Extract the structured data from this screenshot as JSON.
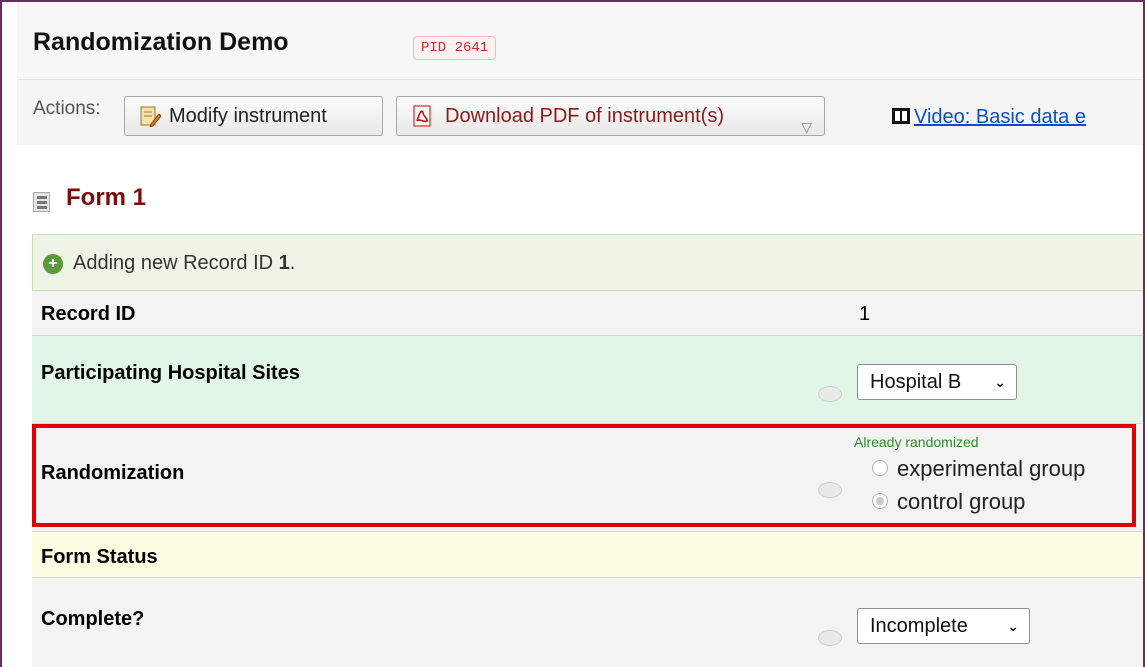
{
  "header": {
    "title": "Randomization Demo",
    "pid": "PID 2641"
  },
  "actions": {
    "label": "Actions:",
    "modify_label": "Modify instrument",
    "pdf_label": "Download PDF of instrument(s)",
    "video_label": "Video: Basic data e"
  },
  "form": {
    "title": "Form 1",
    "notice_prefix": "Adding new Record ID ",
    "notice_id": "1",
    "notice_suffix": ".",
    "fields": {
      "record_id": {
        "label": "Record ID",
        "value": "1"
      },
      "hospital": {
        "label": "Participating Hospital Sites",
        "value": "Hospital B"
      },
      "randomization": {
        "label": "Randomization",
        "note": "Already randomized",
        "options": [
          "experimental group",
          "control group"
        ],
        "selected": "control group"
      },
      "form_status": {
        "label": "Form Status"
      },
      "complete": {
        "label": "Complete?",
        "value": "Incomplete"
      }
    }
  },
  "icons": {
    "modify": "pencil-form-icon",
    "pdf": "pdf-icon",
    "video": "film-icon",
    "form": "form-icon",
    "notice": "plus-circle-icon",
    "comment": "comment-bubble-icon"
  },
  "colors": {
    "form_title": "#7b0c0c",
    "highlight": "#e00000",
    "note": "#2e8a2e",
    "link": "#0e4ec2"
  }
}
